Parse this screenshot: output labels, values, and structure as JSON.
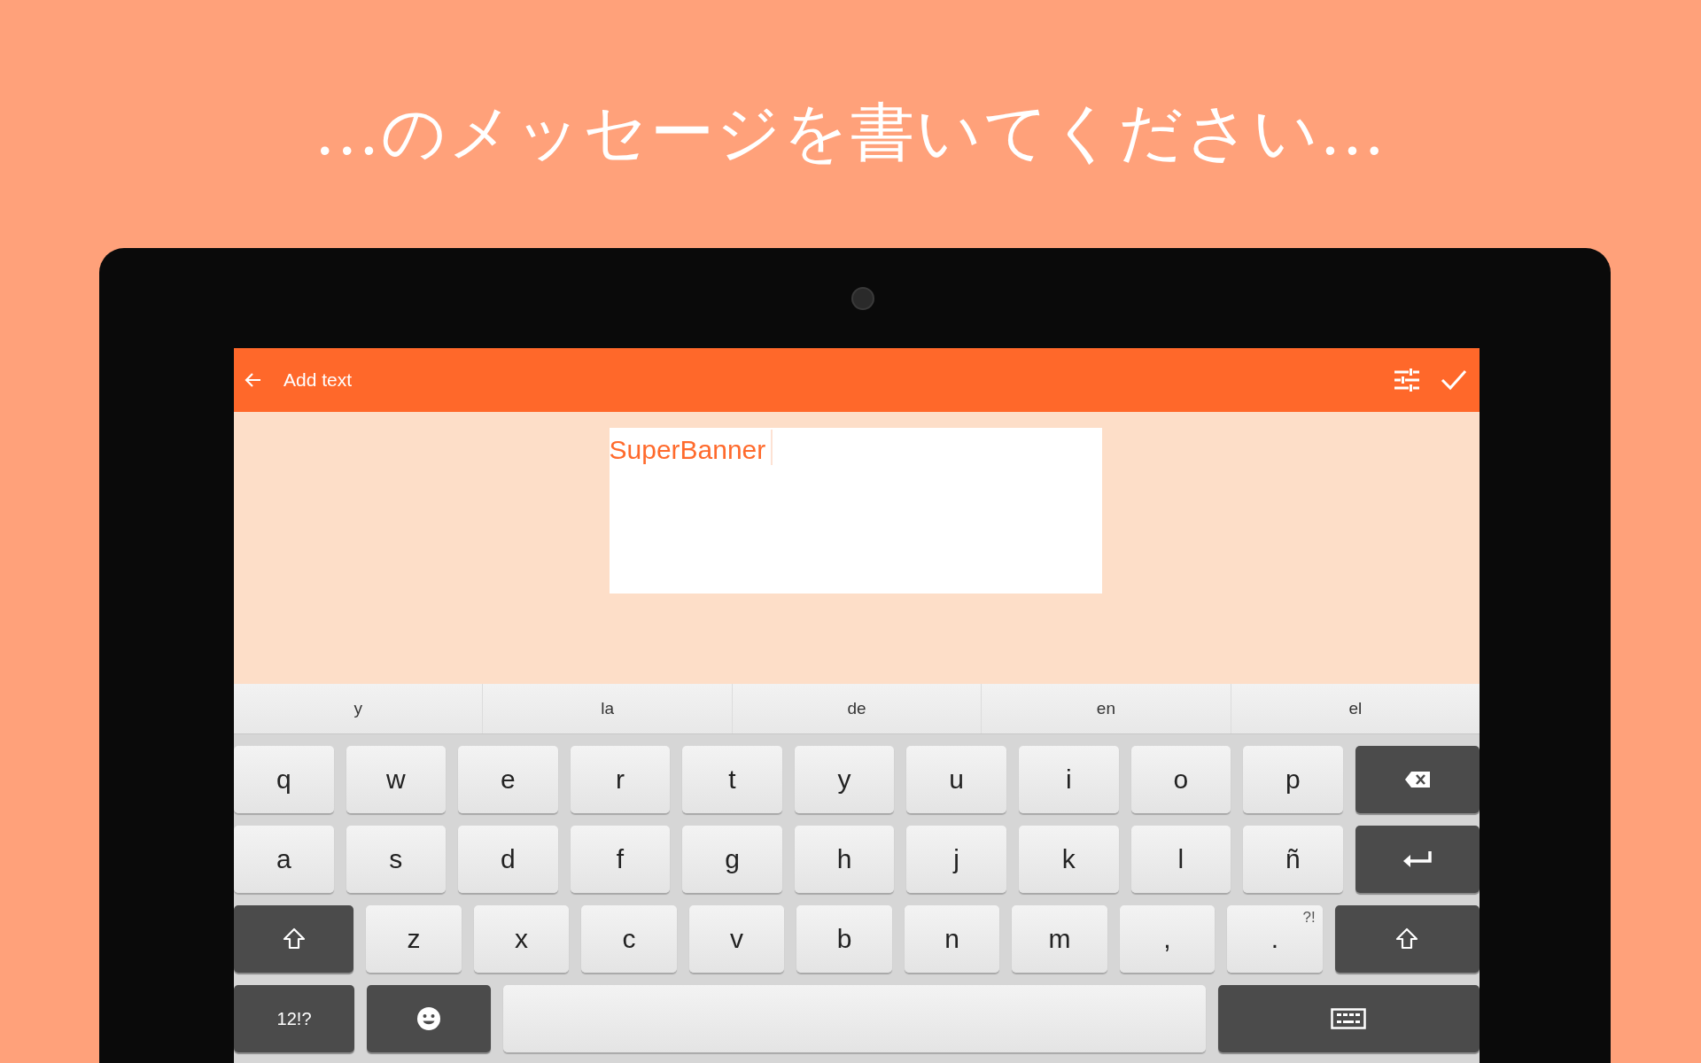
{
  "headline": "...のメッセージを書いてください...",
  "app_bar": {
    "title": "Add text"
  },
  "text_field": {
    "value": "SuperBanner"
  },
  "suggestions": [
    "y",
    "la",
    "de",
    "en",
    "el"
  ],
  "keyboard": {
    "rows": [
      [
        {
          "kind": "letter",
          "label": "q"
        },
        {
          "kind": "letter",
          "label": "w"
        },
        {
          "kind": "letter",
          "label": "e"
        },
        {
          "kind": "letter",
          "label": "r"
        },
        {
          "kind": "letter",
          "label": "t"
        },
        {
          "kind": "letter",
          "label": "y"
        },
        {
          "kind": "letter",
          "label": "u"
        },
        {
          "kind": "letter",
          "label": "i"
        },
        {
          "kind": "letter",
          "label": "o"
        },
        {
          "kind": "letter",
          "label": "p"
        },
        {
          "kind": "backspace"
        }
      ],
      [
        {
          "kind": "letter",
          "label": "a"
        },
        {
          "kind": "letter",
          "label": "s"
        },
        {
          "kind": "letter",
          "label": "d"
        },
        {
          "kind": "letter",
          "label": "f"
        },
        {
          "kind": "letter",
          "label": "g"
        },
        {
          "kind": "letter",
          "label": "h"
        },
        {
          "kind": "letter",
          "label": "j"
        },
        {
          "kind": "letter",
          "label": "k"
        },
        {
          "kind": "letter",
          "label": "l"
        },
        {
          "kind": "letter",
          "label": "ñ"
        },
        {
          "kind": "enter"
        }
      ],
      [
        {
          "kind": "shift"
        },
        {
          "kind": "letter",
          "label": "z"
        },
        {
          "kind": "letter",
          "label": "x"
        },
        {
          "kind": "letter",
          "label": "c"
        },
        {
          "kind": "letter",
          "label": "v"
        },
        {
          "kind": "letter",
          "label": "b"
        },
        {
          "kind": "letter",
          "label": "n"
        },
        {
          "kind": "letter",
          "label": "m"
        },
        {
          "kind": "letter",
          "label": ","
        },
        {
          "kind": "letter",
          "label": ".",
          "hint": "?!"
        },
        {
          "kind": "shift"
        }
      ],
      [
        {
          "kind": "symbols",
          "label": "12!?"
        },
        {
          "kind": "emoji"
        },
        {
          "kind": "space"
        },
        {
          "kind": "hide"
        }
      ]
    ]
  }
}
